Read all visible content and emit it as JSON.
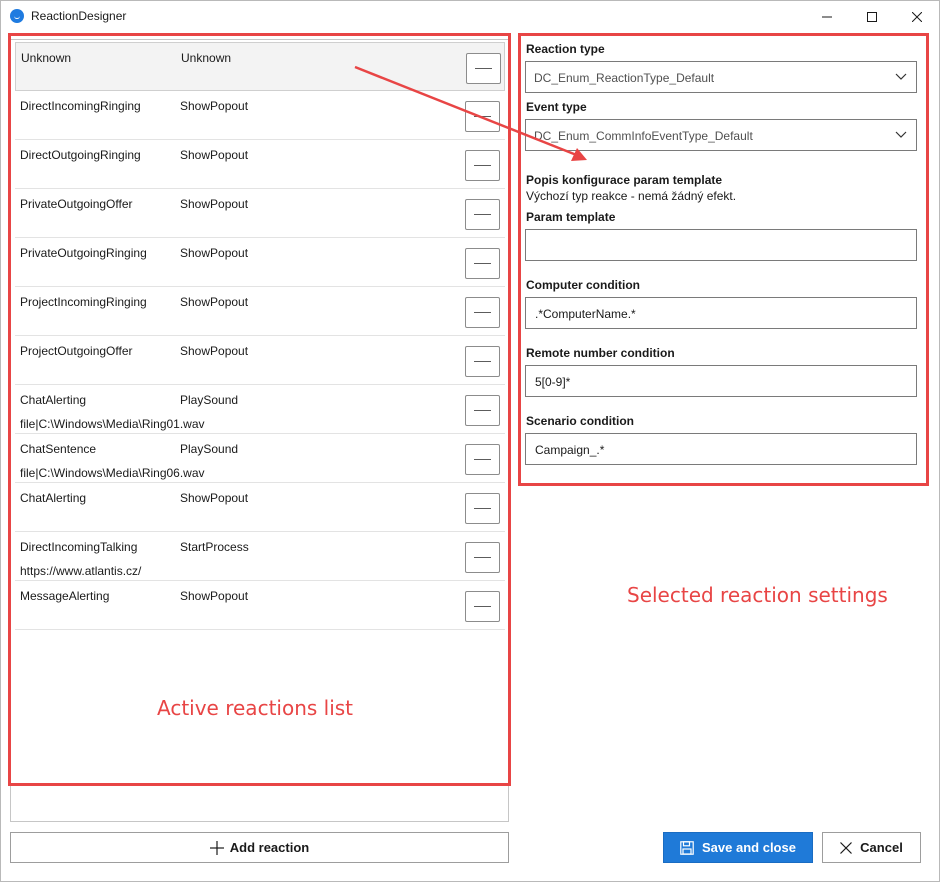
{
  "window": {
    "title": "ReactionDesigner"
  },
  "reactions": [
    {
      "event": "Unknown",
      "reaction": "Unknown",
      "param": ""
    },
    {
      "event": "DirectIncomingRinging",
      "reaction": "ShowPopout",
      "param": ""
    },
    {
      "event": "DirectOutgoingRinging",
      "reaction": "ShowPopout",
      "param": ""
    },
    {
      "event": "PrivateOutgoingOffer",
      "reaction": "ShowPopout",
      "param": ""
    },
    {
      "event": "PrivateOutgoingRinging",
      "reaction": "ShowPopout",
      "param": ""
    },
    {
      "event": "ProjectIncomingRinging",
      "reaction": "ShowPopout",
      "param": ""
    },
    {
      "event": "ProjectOutgoingOffer",
      "reaction": "ShowPopout",
      "param": ""
    },
    {
      "event": "ChatAlerting",
      "reaction": "PlaySound",
      "param": "file|C:\\Windows\\Media\\Ring01.wav"
    },
    {
      "event": "ChatSentence",
      "reaction": "PlaySound",
      "param": "file|C:\\Windows\\Media\\Ring06.wav"
    },
    {
      "event": "ChatAlerting",
      "reaction": "ShowPopout",
      "param": ""
    },
    {
      "event": "DirectIncomingTalking",
      "reaction": "StartProcess",
      "param": "https://www.atlantis.cz/"
    },
    {
      "event": "MessageAlerting",
      "reaction": "ShowPopout",
      "param": ""
    }
  ],
  "settings": {
    "reaction_type_label": "Reaction type",
    "reaction_type_value": "DC_Enum_ReactionType_Default",
    "event_type_label": "Event type",
    "event_type_value": "DC_Enum_CommInfoEventType_Default",
    "description_title": "Popis konfigurace param template",
    "description_text": "Výchozí typ reakce - nemá žádný efekt.",
    "param_template_label": "Param template",
    "param_template_value": "",
    "computer_condition_label": "Computer condition",
    "computer_condition_value": ".*ComputerName.*",
    "remote_number_label": "Remote number condition",
    "remote_number_value": "5[0-9]*",
    "scenario_label": "Scenario condition",
    "scenario_value": "Campaign_.*"
  },
  "annotations": {
    "list_label": "Active reactions list",
    "settings_label": "Selected reaction settings",
    "color": "#e84545"
  },
  "buttons": {
    "add": "Add reaction",
    "save": "Save and close",
    "cancel": "Cancel"
  },
  "colors": {
    "accent": "#1f7ad8"
  },
  "icons": {
    "app": "app-icon",
    "remove": "minus-icon",
    "add": "plus-icon",
    "save": "floppy-icon",
    "cancel": "close-icon",
    "dropdown": "chevron-down-icon"
  }
}
